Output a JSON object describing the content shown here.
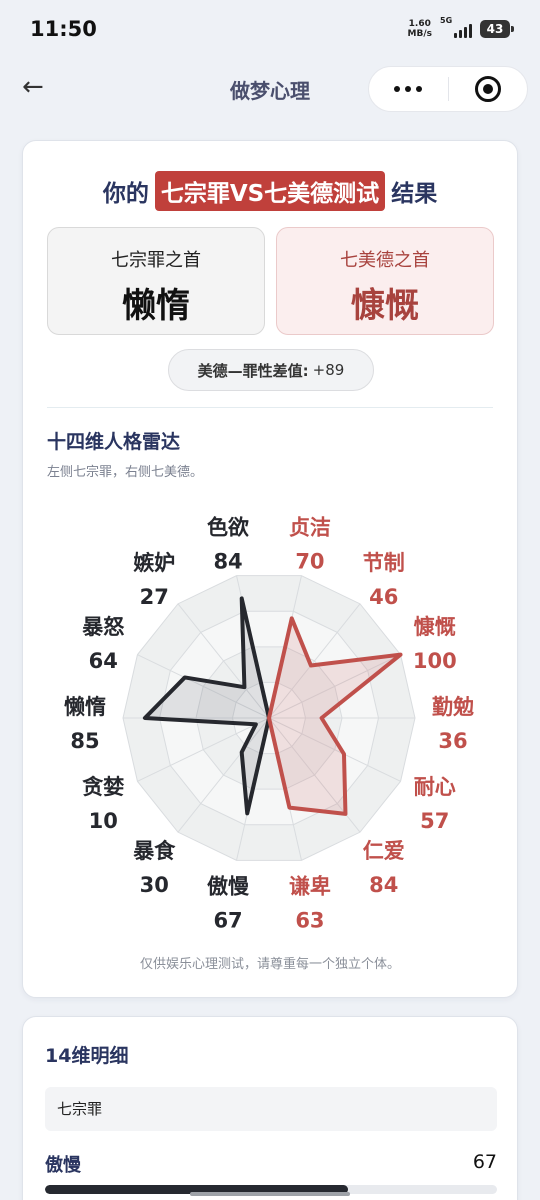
{
  "status": {
    "time": "11:50",
    "net_speed_value": "1.60",
    "net_speed_unit": "MB/s",
    "network": "5G",
    "battery": "43"
  },
  "nav": {
    "title": "做梦心理",
    "back_icon": "←"
  },
  "result": {
    "title_prefix": "你的",
    "title_highlight": "七宗罪VS七美德测试",
    "title_suffix": "结果",
    "sin_label": "七宗罪之首",
    "sin_value": "懒惰",
    "virtue_label": "七美德之首",
    "virtue_value": "慷慨",
    "diff_label": "美德—罪性差值:",
    "diff_value": "+89"
  },
  "radar": {
    "title": "十四维人格雷达",
    "subtitle": "左侧七宗罪，右侧七美德。",
    "footnote": "仅供娱乐心理测试，请尊重每一个独立个体。"
  },
  "colors": {
    "sin": "#26282e",
    "virtue": "#c0504b",
    "accent": "#2a3560"
  },
  "chart_data": {
    "type": "radar",
    "max": 100,
    "series": [
      {
        "name": "七宗罪",
        "axes": [
          {
            "label": "色欲",
            "value": 84
          },
          {
            "label": "嫉妒",
            "value": 27
          },
          {
            "label": "暴怒",
            "value": 64
          },
          {
            "label": "懒惰",
            "value": 85
          },
          {
            "label": "贪婪",
            "value": 10
          },
          {
            "label": "暴食",
            "value": 30
          },
          {
            "label": "傲慢",
            "value": 67
          }
        ]
      },
      {
        "name": "七美德",
        "axes": [
          {
            "label": "贞洁",
            "value": 70
          },
          {
            "label": "节制",
            "value": 46
          },
          {
            "label": "慷慨",
            "value": 100
          },
          {
            "label": "勤勉",
            "value": 36
          },
          {
            "label": "耐心",
            "value": 57
          },
          {
            "label": "仁爱",
            "value": 84
          },
          {
            "label": "谦卑",
            "value": 63
          }
        ]
      }
    ]
  },
  "detail": {
    "title": "14维明细",
    "group_label": "七宗罪",
    "first_row": {
      "name": "傲慢",
      "value": "67",
      "percent": 67
    }
  }
}
